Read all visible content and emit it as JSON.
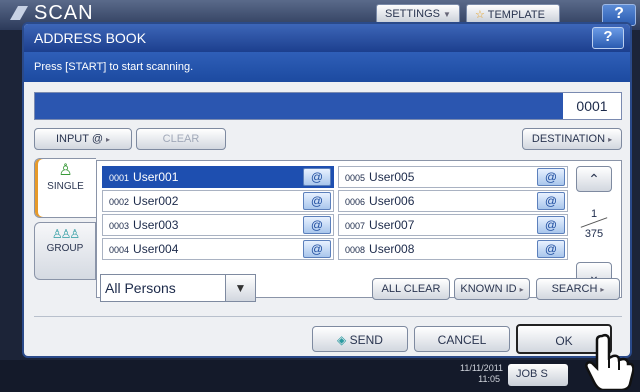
{
  "background": {
    "title": "SCAN",
    "settings_label": "SETTINGS",
    "template_label": "TEMPLATE",
    "help_label": "?",
    "clock_date": "11/11/2011",
    "clock_time": "11:05",
    "job_label": "JOB S"
  },
  "dialog": {
    "title": "ADDRESS BOOK",
    "help_label": "?",
    "message": "Press [START] to start scanning.",
    "destination_count": "0001"
  },
  "toolbar": {
    "input_label": "INPUT @",
    "clear_label": "CLEAR",
    "destination_label": "DESTINATION"
  },
  "tabs": {
    "single_label": "SINGLE",
    "group_label": "GROUP"
  },
  "entries": [
    {
      "num": "0001",
      "name": "User001"
    },
    {
      "num": "0002",
      "name": "User002"
    },
    {
      "num": "0003",
      "name": "User003"
    },
    {
      "num": "0004",
      "name": "User004"
    },
    {
      "num": "0005",
      "name": "User005"
    },
    {
      "num": "0006",
      "name": "User006"
    },
    {
      "num": "0007",
      "name": "User007"
    },
    {
      "num": "0008",
      "name": "User008"
    }
  ],
  "pager": {
    "current": "1",
    "total": "375"
  },
  "filter": {
    "selected": "All Persons"
  },
  "actions": {
    "all_clear_label": "ALL CLEAR",
    "known_id_label": "KNOWN ID",
    "search_label": "SEARCH",
    "send_label": "SEND",
    "cancel_label": "CANCEL",
    "ok_label": "OK"
  },
  "colors": {
    "accent": "#1e4fb0",
    "title_bar": "#2a56b0",
    "single_tab_marker": "#e69a2a"
  }
}
